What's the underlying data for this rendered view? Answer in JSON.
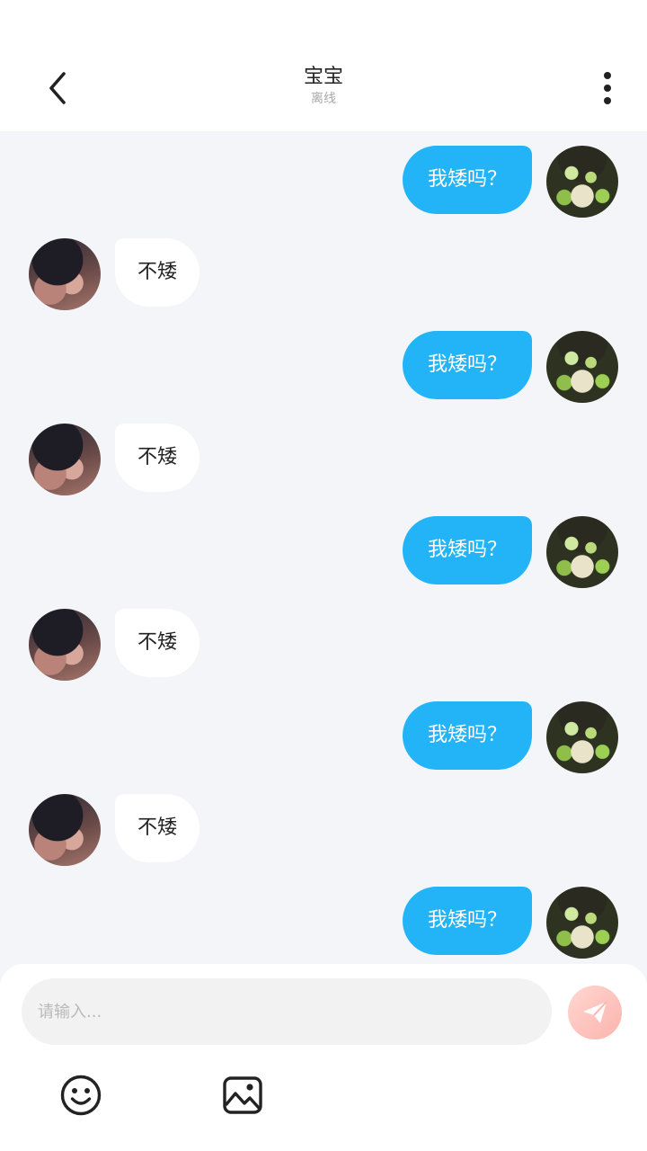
{
  "header": {
    "title": "宝宝",
    "status": "离线"
  },
  "messages": [
    {
      "side": "right",
      "text": "我矮吗？"
    },
    {
      "side": "left",
      "text": "不矮"
    },
    {
      "side": "right",
      "text": "我矮吗？"
    },
    {
      "side": "left",
      "text": "不矮"
    },
    {
      "side": "right",
      "text": "我矮吗？"
    },
    {
      "side": "left",
      "text": "不矮"
    },
    {
      "side": "right",
      "text": "我矮吗？"
    },
    {
      "side": "left",
      "text": "不矮"
    },
    {
      "side": "right",
      "text": "我矮吗？"
    }
  ],
  "composer": {
    "placeholder": "请输入...",
    "value": ""
  },
  "icons": {
    "back": "chevron-left-icon",
    "more": "more-vertical-icon",
    "send": "paper-plane-icon",
    "emoji": "smile-icon",
    "image": "image-icon"
  },
  "colors": {
    "accent": "#23b4f8",
    "chat_background": "#f3f5f8",
    "send_button": "#fba7a0"
  }
}
